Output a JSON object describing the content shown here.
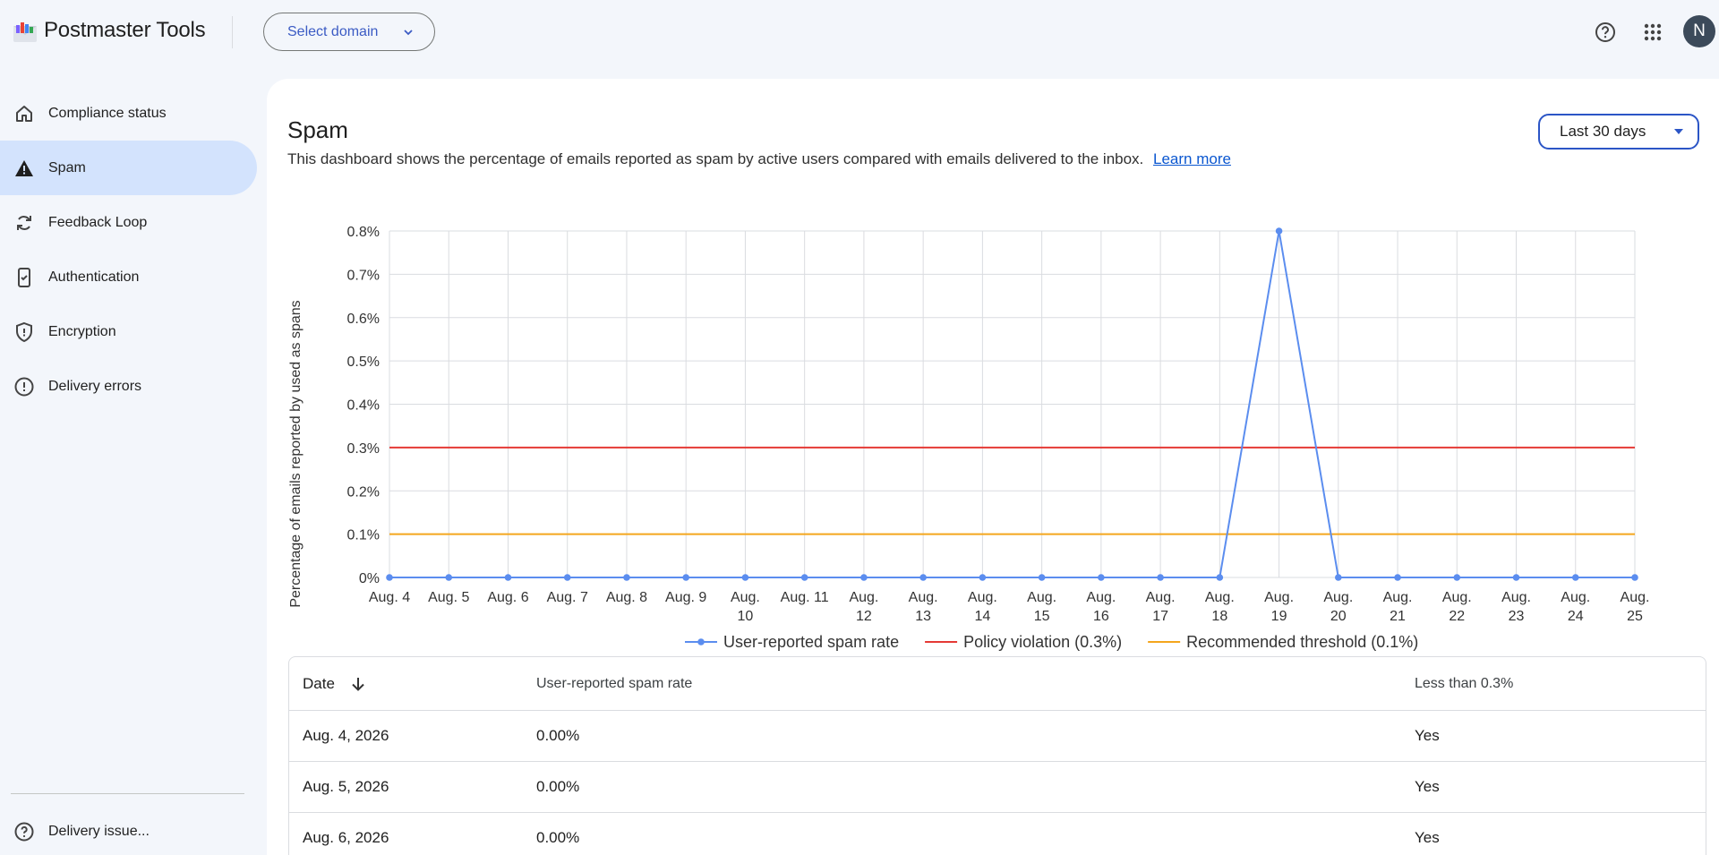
{
  "app": {
    "title": "Postmaster Tools",
    "domain_select_label": "Select domain",
    "avatar_initial": "N",
    "accent_color": "#0b57d0"
  },
  "sidebar": {
    "items": [
      {
        "label": "Compliance status",
        "icon": "home-icon",
        "active": false
      },
      {
        "label": "Spam",
        "icon": "warning-icon",
        "active": true
      },
      {
        "label": "Feedback Loop",
        "icon": "sync-icon",
        "active": false
      },
      {
        "label": "Authentication",
        "icon": "phone-check-icon",
        "active": false
      },
      {
        "label": "Encryption",
        "icon": "shield-icon",
        "active": false
      },
      {
        "label": "Delivery errors",
        "icon": "error-icon",
        "active": false
      }
    ],
    "footer_item": {
      "label": "Delivery issue...",
      "icon": "help-icon"
    }
  },
  "page": {
    "title": "Spam",
    "description": "This dashboard shows the percentage of emails reported as spam by active users compared with emails delivered to the inbox.",
    "learn_more": "Learn more",
    "range_label": "Last 30 days"
  },
  "chart_data": {
    "type": "line",
    "ylabel": "Percentage of emails reported by used as spans",
    "ylim": [
      0,
      0.8
    ],
    "yticks": [
      "0%",
      "0.1%",
      "0.2%",
      "0.3%",
      "0.4%",
      "0.5%",
      "0.6%",
      "0.7%",
      "0.8%"
    ],
    "x": [
      [
        "Aug. 4"
      ],
      [
        "Aug. 5"
      ],
      [
        "Aug. 6"
      ],
      [
        "Aug. 7"
      ],
      [
        "Aug. 8"
      ],
      [
        "Aug. 9"
      ],
      [
        "Aug.",
        "10"
      ],
      [
        "Aug. 11"
      ],
      [
        "Aug.",
        "12"
      ],
      [
        "Aug.",
        "13"
      ],
      [
        "Aug.",
        "14"
      ],
      [
        "Aug.",
        "15"
      ],
      [
        "Aug.",
        "16"
      ],
      [
        "Aug.",
        "17"
      ],
      [
        "Aug.",
        "18"
      ],
      [
        "Aug.",
        "19"
      ],
      [
        "Aug.",
        "20"
      ],
      [
        "Aug.",
        "21"
      ],
      [
        "Aug.",
        "22"
      ],
      [
        "Aug.",
        "23"
      ],
      [
        "Aug.",
        "24"
      ],
      [
        "Aug.",
        "25"
      ]
    ],
    "grid": true,
    "legend": "bottom",
    "series": [
      {
        "name": "User-reported spam rate",
        "color": "#5b8def",
        "values": [
          0,
          0,
          0,
          0,
          0,
          0,
          0,
          0,
          0,
          0,
          0,
          0,
          0,
          0,
          0,
          0.8,
          0,
          0,
          0,
          0,
          0,
          0
        ]
      },
      {
        "name": "Policy violation (0.3%)",
        "color": "#e53935",
        "constant": 0.3
      },
      {
        "name": "Recommended threshold (0.1%)",
        "color": "#f4a61d",
        "constant": 0.1
      }
    ]
  },
  "table": {
    "headers": [
      "Date",
      "User-reported spam rate",
      "Less than 0.3%"
    ],
    "rows": [
      [
        "Aug. 4, 2026",
        "0.00%",
        "Yes"
      ],
      [
        "Aug. 5, 2026",
        "0.00%",
        "Yes"
      ],
      [
        "Aug. 6, 2026",
        "0.00%",
        "Yes"
      ]
    ]
  }
}
